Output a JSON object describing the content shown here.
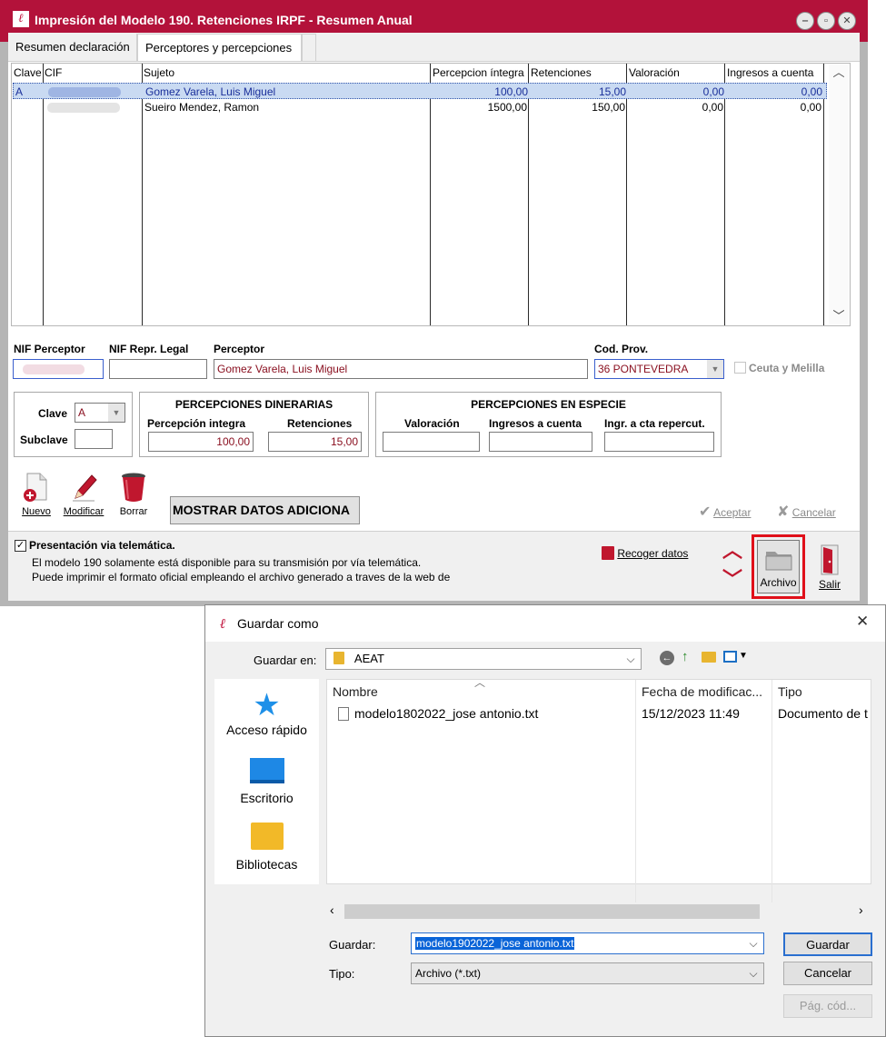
{
  "main_window": {
    "title": "Impresión del Modelo 190. Retenciones IRPF - Resumen Anual",
    "app_logo_glyph": "A",
    "title_buttons": {
      "minimize": "‒",
      "maximize": "▫",
      "close": "✕"
    },
    "tabs": [
      {
        "label": "Resumen declaración",
        "active": false
      },
      {
        "label": "Perceptores y percepciones",
        "active": true
      }
    ],
    "grid": {
      "columns": [
        "Clave",
        "CIF",
        "Sujeto",
        "Percepcion íntegra",
        "Retenciones",
        "Valoración",
        "Ingresos a cuenta"
      ],
      "rows": [
        {
          "clave": "A",
          "cif": "",
          "sujeto": "Gomez Varela, Luis Miguel",
          "percepcion": "100,00",
          "retenciones": "15,00",
          "valoracion": "0,00",
          "ingresos": "0,00",
          "selected": true
        },
        {
          "clave": "",
          "cif": "",
          "sujeto": "Sueiro Mendez, Ramon",
          "percepcion": "1500,00",
          "retenciones": "150,00",
          "valoracion": "0,00",
          "ingresos": "0,00",
          "selected": false
        }
      ]
    },
    "detail": {
      "nif_perceptor_label": "NIF Perceptor",
      "nif_repr_label": "NIF Repr. Legal",
      "perceptor_label": "Perceptor",
      "perceptor_value": "Gomez Varela, Luis Miguel",
      "cod_prov_label": "Cod. Prov.",
      "cod_prov_value": "36  PONTEVEDRA",
      "ceuta_label": "Ceuta y Melilla",
      "clave_label": "Clave",
      "clave_value": "A",
      "subclave_label": "Subclave",
      "dinerarias_title": "PERCEPCIONES DINERARIAS",
      "percepcion_integra_label": "Percepción integra",
      "percepcion_integra_value": "100,00",
      "retenciones_label": "Retenciones",
      "retenciones_value": "15,00",
      "especie_title": "PERCEPCIONES EN ESPECIE",
      "valoracion_label": "Valoración",
      "ingresos_label": "Ingresos a cuenta",
      "ingr_repercut_label": "Ingr. a cta repercut."
    },
    "toolbar": {
      "nuevo": "Nuevo",
      "modificar": "Modificar",
      "borrar": "Borrar",
      "mostrar": "MOSTRAR DATOS ADICIONA",
      "aceptar": "Aceptar",
      "cancelar": "Cancelar"
    },
    "bottom": {
      "telematica_label": "Presentación via telemática.",
      "info_line1": "El modelo 190 solamente está disponible para su transmisión por vía telemática.",
      "info_line2": "Puede imprimir el formato oficial empleando el archivo generado a traves de la web de",
      "recoger": "Recoger datos",
      "archivo": "Archivo",
      "salir": "Salir"
    },
    "colors": {
      "title_bar": "#b3123a",
      "highlight_border": "#e0101a"
    }
  },
  "dialog": {
    "title": "Guardar como",
    "close_glyph": "✕",
    "guardar_en_label": "Guardar en:",
    "location": "AEAT",
    "places": [
      "Acceso rápido",
      "Escritorio",
      "Bibliotecas"
    ],
    "columns": [
      "Nombre",
      "Fecha de modificac...",
      "Tipo"
    ],
    "files": [
      {
        "name": "modelo1802022_jose antonio.txt",
        "date": "15/12/2023 11:49",
        "type": "Documento de t"
      }
    ],
    "guardar_label": "Guardar:",
    "filename": "modelo1902022_jose antonio.txt",
    "tipo_label": "Tipo:",
    "tipo_value": "Archivo (*.txt)",
    "buttons": {
      "guardar": "Guardar",
      "cancelar": "Cancelar",
      "pag_cod": "Pág. cód..."
    }
  }
}
